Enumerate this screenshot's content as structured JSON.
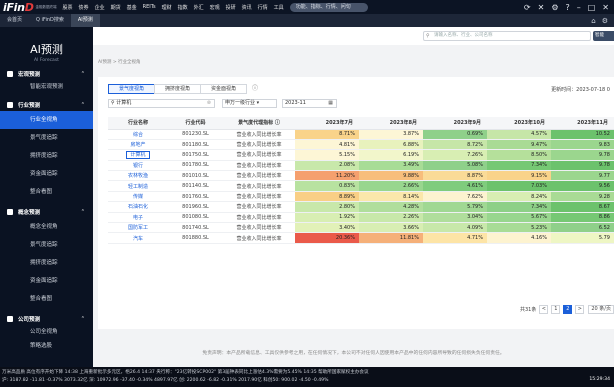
{
  "app": {
    "logo": "iFinD",
    "logo_sub": "金融数据终端"
  },
  "top_menu": [
    "股票",
    "债券",
    "企业",
    "期货",
    "基金",
    "REITs",
    "理财",
    "指数",
    "外汇",
    "宏观",
    "投研",
    "资讯",
    "行情",
    "工具"
  ],
  "top_search": "功能、指标、行情、问句",
  "tabs": [
    {
      "label": "会首页"
    },
    {
      "label": "Q iFinD搜索"
    },
    {
      "label": "AI预测"
    }
  ],
  "sidebar": {
    "title": "AI预测",
    "subtitle": "AI Forecast",
    "groups": [
      {
        "label": "宏观预测",
        "items": [
          "智能宏观预测"
        ]
      },
      {
        "label": "行业预测",
        "items": [
          "行业全视角",
          "景气度追踪",
          "拥挤度追踪",
          "资金面追踪",
          "整合看图"
        ]
      },
      {
        "label": "概念预测",
        "items": [
          "概念全视角",
          "景气度追踪",
          "拥挤度追踪",
          "资金面追踪",
          "整合看图"
        ]
      },
      {
        "label": "公司预测",
        "items": [
          "公司全视角",
          "策略选股"
        ]
      }
    ]
  },
  "search": {
    "placeholder": "请输入名称、行业、公司名称",
    "smart_label": "智能"
  },
  "breadcrumb": "AI预测 > 行业全视角",
  "subtabs": [
    "景气度视角",
    "拥挤度视角",
    "资金面视角"
  ],
  "updated": "更新时间：2023-07-18 0",
  "filters": {
    "industry": "计算机",
    "level": "申万一级行业",
    "date": "2023-11"
  },
  "table": {
    "headers": [
      "行业名称",
      "行业代码",
      "景气度代理指标 ⓘ",
      "2023年7月",
      "2023年8月",
      "2023年9月",
      "2023年10月",
      "2023年11月"
    ],
    "rows": [
      {
        "name": "综合",
        "code": "801230.SL",
        "metric": "营业收入同比增长率",
        "values": [
          "8.71%",
          "3.87%",
          "0.69%",
          "4.57%",
          "10.52"
        ]
      },
      {
        "name": "房地产",
        "code": "801180.SL",
        "metric": "营业收入同比增长率",
        "values": [
          "4.81%",
          "6.88%",
          "8.72%",
          "9.47%",
          "9.83"
        ]
      },
      {
        "name": "计算机",
        "code": "801750.SL",
        "metric": "营业收入同比增长率",
        "values": [
          "5.15%",
          "6.19%",
          "7.26%",
          "8.50%",
          "9.78"
        ]
      },
      {
        "name": "银行",
        "code": "801780.SL",
        "metric": "营业收入同比增长率",
        "values": [
          "2.08%",
          "3.49%",
          "5.08%",
          "7.34%",
          "9.78"
        ]
      },
      {
        "name": "农林牧渔",
        "code": "801010.SL",
        "metric": "营业收入同比增长率",
        "values": [
          "11.20%",
          "9.88%",
          "8.87%",
          "9.15%",
          "9.77"
        ]
      },
      {
        "name": "轻工制造",
        "code": "801140.SL",
        "metric": "营业收入同比增长率",
        "values": [
          "0.83%",
          "2.66%",
          "4.61%",
          "7.03%",
          "9.56"
        ]
      },
      {
        "name": "传媒",
        "code": "801760.SL",
        "metric": "营业收入同比增长率",
        "values": [
          "8.89%",
          "8.14%",
          "7.62%",
          "8.24%",
          "9.28"
        ]
      },
      {
        "name": "石油石化",
        "code": "801960.SL",
        "metric": "营业收入同比增长率",
        "values": [
          "2.80%",
          "4.28%",
          "5.79%",
          "7.34%",
          "8.67"
        ]
      },
      {
        "name": "电子",
        "code": "801080.SL",
        "metric": "营业收入同比增长率",
        "values": [
          "1.92%",
          "2.26%",
          "3.04%",
          "5.67%",
          "8.86"
        ]
      },
      {
        "name": "国防军工",
        "code": "801740.SL",
        "metric": "营业收入同比增长率",
        "values": [
          "3.40%",
          "3.66%",
          "4.09%",
          "5.23%",
          "6.52"
        ]
      },
      {
        "name": "汽车",
        "code": "801880.SL",
        "metric": "营业收入同比增长率",
        "values": [
          "20.36%",
          "11.81%",
          "4.71%",
          "4.16%",
          "5.79"
        ]
      }
    ],
    "colors": [
      [
        "#f9d38a",
        "#fdf6d6",
        "#8fd08a",
        "#c6e6a8",
        "#6cc26c"
      ],
      [
        "#fdf6d6",
        "#e8f2bd",
        "#c6e6a8",
        "#a9db95",
        "#9bd68e"
      ],
      [
        "#fdf6d6",
        "#f2f6cb",
        "#d8eeb3",
        "#b5e09b",
        "#9bd68e"
      ],
      [
        "#c8e8aa",
        "#a8dc96",
        "#8fd08a",
        "#76c874",
        "#6cc26c"
      ],
      [
        "#f5a06e",
        "#f7be7c",
        "#fadb97",
        "#f9d38a",
        "#9bd68e"
      ],
      [
        "#b8e2a0",
        "#98d68e",
        "#7fcc7d",
        "#6cc26c",
        "#6cc26c"
      ],
      [
        "#f9cf86",
        "#fbe7ab",
        "#fdf3d0",
        "#d8eeb3",
        "#a9db95"
      ],
      [
        "#c8e8aa",
        "#b0de9c",
        "#a0d893",
        "#8dd087",
        "#6cc26c"
      ],
      [
        "#d8eeb3",
        "#c8e8aa",
        "#b0de9c",
        "#98d68e",
        "#76c874"
      ],
      [
        "#e2f1b8",
        "#d8eeb3",
        "#c8e8aa",
        "#a8dc96",
        "#8fd08a"
      ],
      [
        "#ea5a4a",
        "#f5b079",
        "#fde4a6",
        "#fdf3d0",
        "#eef6c4"
      ]
    ]
  },
  "pagination": {
    "total": "共31条",
    "prev": "<",
    "p1": "1",
    "p2": "2",
    "next": ">",
    "size": "20 条/页"
  },
  "disclaimer": "免责声明：本产品所载信息、工具仅供参考之用，在任何情况下，本公司不对任何人因使用本产品中的任何内容所导致的任何损失负任何责任。",
  "ticker": {
    "news": "万米高品质 高位有序开始下降    14:38 上海重新批示多元区，梧26.4    14:37 央行称：\"23亿转投SCP002\" 第3届钟表同比上涨估4.3%需要为5.45%    14:35 帮助所国家赋权主办会议",
    "quotes": "沪: 3187.82 -11.81 -0.37% 3073.32亿  深: 10972.96 -37.40 -0.34% 4897.97亿  创: 2200.62 -6.82 -0.31% 2017.90亿  科创50: 900.02 -4.50 -0.49%",
    "time": "15:29:34"
  }
}
